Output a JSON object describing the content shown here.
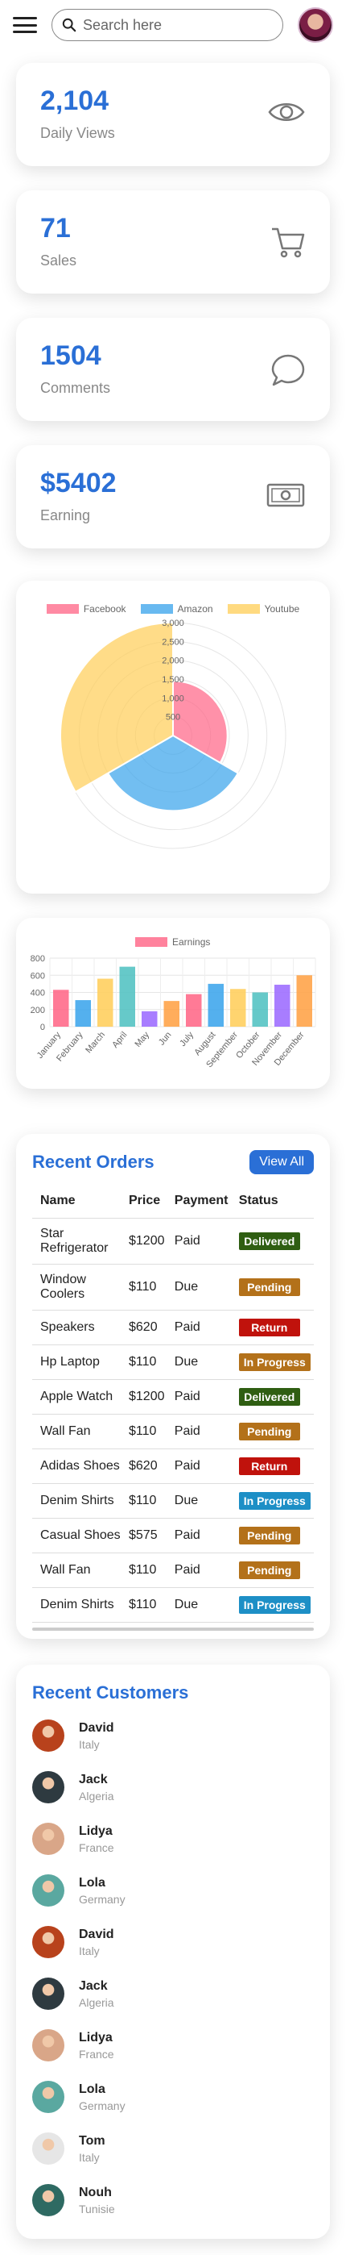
{
  "search": {
    "placeholder": "Search here"
  },
  "stats": [
    {
      "value": "2,104",
      "label": "Daily Views",
      "icon": "eye-icon"
    },
    {
      "value": "71",
      "label": "Sales",
      "icon": "cart-icon"
    },
    {
      "value": "1504",
      "label": "Comments",
      "icon": "chat-icon"
    },
    {
      "value": "$5402",
      "label": "Earning",
      "icon": "money-icon"
    }
  ],
  "chart_data": [
    {
      "type": "polarArea",
      "series": [
        {
          "name": "Facebook",
          "value": 1450,
          "color": "#ff6384"
        },
        {
          "name": "Amazon",
          "value": 2000,
          "color": "#36a2eb"
        },
        {
          "name": "Youtube",
          "value": 3000,
          "color": "#ffcd56"
        }
      ],
      "ticks": [
        "500",
        "1,000",
        "1,500",
        "2,000",
        "2,500",
        "3,000"
      ],
      "rlim": [
        0,
        3000
      ]
    },
    {
      "type": "bar",
      "series": [
        {
          "name": "Earnings",
          "color": "#ff6384"
        }
      ],
      "categories": [
        "January",
        "February",
        "March",
        "April",
        "May",
        "Jun",
        "July",
        "August",
        "September",
        "October",
        "November",
        "December"
      ],
      "values": [
        430,
        310,
        560,
        700,
        180,
        300,
        380,
        500,
        440,
        400,
        490,
        600
      ],
      "colors": [
        "#ff6384",
        "#36a2eb",
        "#ffcd56",
        "#4bc0c0",
        "#9966ff",
        "#ff9f40",
        "#ff6384",
        "#36a2eb",
        "#ffcd56",
        "#4bc0c0",
        "#9966ff",
        "#ff9f40"
      ],
      "yticks": [
        "0",
        "200",
        "400",
        "600",
        "800"
      ],
      "ylim": [
        0,
        800
      ]
    }
  ],
  "orders": {
    "title": "Recent Orders",
    "view_all": "View All",
    "headers": [
      "Name",
      "Price",
      "Payment",
      "Status"
    ],
    "rows": [
      {
        "name": "Star Refrigerator",
        "price": "$1200",
        "payment": "Paid",
        "status": "Delivered",
        "color": "#2f5e12"
      },
      {
        "name": "Window Coolers",
        "price": "$110",
        "payment": "Due",
        "status": "Pending",
        "color": "#b3711a"
      },
      {
        "name": "Speakers",
        "price": "$620",
        "payment": "Paid",
        "status": "Return",
        "color": "#c0120c"
      },
      {
        "name": "Hp Laptop",
        "price": "$110",
        "payment": "Due",
        "status": "In Progress",
        "color": "#b3711a"
      },
      {
        "name": "Apple Watch",
        "price": "$1200",
        "payment": "Paid",
        "status": "Delivered",
        "color": "#2f5e12"
      },
      {
        "name": "Wall Fan",
        "price": "$110",
        "payment": "Paid",
        "status": "Pending",
        "color": "#b3711a"
      },
      {
        "name": "Adidas Shoes",
        "price": "$620",
        "payment": "Paid",
        "status": "Return",
        "color": "#c0120c"
      },
      {
        "name": "Denim Shirts",
        "price": "$110",
        "payment": "Due",
        "status": "In Progress",
        "color": "#1d8fc6"
      },
      {
        "name": "Casual Shoes",
        "price": "$575",
        "payment": "Paid",
        "status": "Pending",
        "color": "#b3711a"
      },
      {
        "name": "Wall Fan",
        "price": "$110",
        "payment": "Paid",
        "status": "Pending",
        "color": "#b3711a"
      },
      {
        "name": "Denim Shirts",
        "price": "$110",
        "payment": "Due",
        "status": "In Progress",
        "color": "#1d8fc6"
      }
    ]
  },
  "customers": {
    "title": "Recent Customers",
    "list": [
      {
        "name": "David",
        "country": "Italy",
        "avatar_color": "#b8421c"
      },
      {
        "name": "Jack",
        "country": "Algeria",
        "avatar_color": "#2e3a40"
      },
      {
        "name": "Lidya",
        "country": "France",
        "avatar_color": "#d9a688"
      },
      {
        "name": "Lola",
        "country": "Germany",
        "avatar_color": "#5aa8a0"
      },
      {
        "name": "David",
        "country": "Italy",
        "avatar_color": "#b8421c"
      },
      {
        "name": "Jack",
        "country": "Algeria",
        "avatar_color": "#2e3a40"
      },
      {
        "name": "Lidya",
        "country": "France",
        "avatar_color": "#d9a688"
      },
      {
        "name": "Lola",
        "country": "Germany",
        "avatar_color": "#5aa8a0"
      },
      {
        "name": "Tom",
        "country": "Italy",
        "avatar_color": "#e6e6e6"
      },
      {
        "name": "Nouh",
        "country": "Tunisie",
        "avatar_color": "#2e6a62"
      }
    ]
  }
}
